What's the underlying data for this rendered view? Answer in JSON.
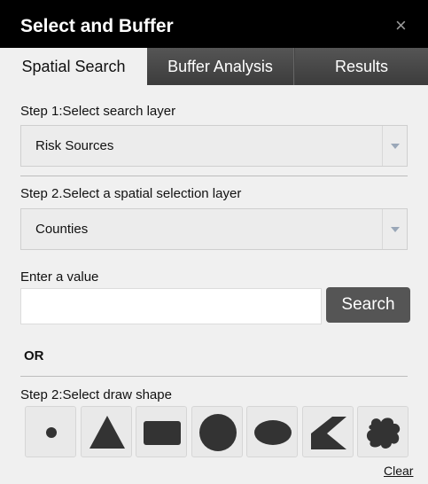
{
  "window": {
    "title": "Select and Buffer",
    "close_glyph": "×"
  },
  "tabs": [
    {
      "label": "Spatial Search",
      "active": true
    },
    {
      "label": "Buffer Analysis",
      "active": false
    },
    {
      "label": "Results",
      "active": false
    }
  ],
  "step1": {
    "label": "Step 1:Select search layer",
    "selected": "Risk Sources"
  },
  "step2": {
    "label": "Step 2.Select a spatial selection layer",
    "selected": "Counties"
  },
  "value": {
    "label": "Enter a value",
    "input_value": "",
    "placeholder": "",
    "search_label": "Search"
  },
  "or_label": "OR",
  "draw": {
    "label": "Step 2:Select draw shape",
    "shapes": [
      "point-icon",
      "triangle-icon",
      "rectangle-icon",
      "circle-icon",
      "ellipse-icon",
      "polygon-icon",
      "freehand-polygon-icon"
    ]
  },
  "clear_label": "Clear",
  "colors": {
    "titlebar": "#000000",
    "tab_bar": "#444444",
    "panel": "#f0f0f0",
    "shape_fill": "#333333",
    "button": "#555555"
  }
}
